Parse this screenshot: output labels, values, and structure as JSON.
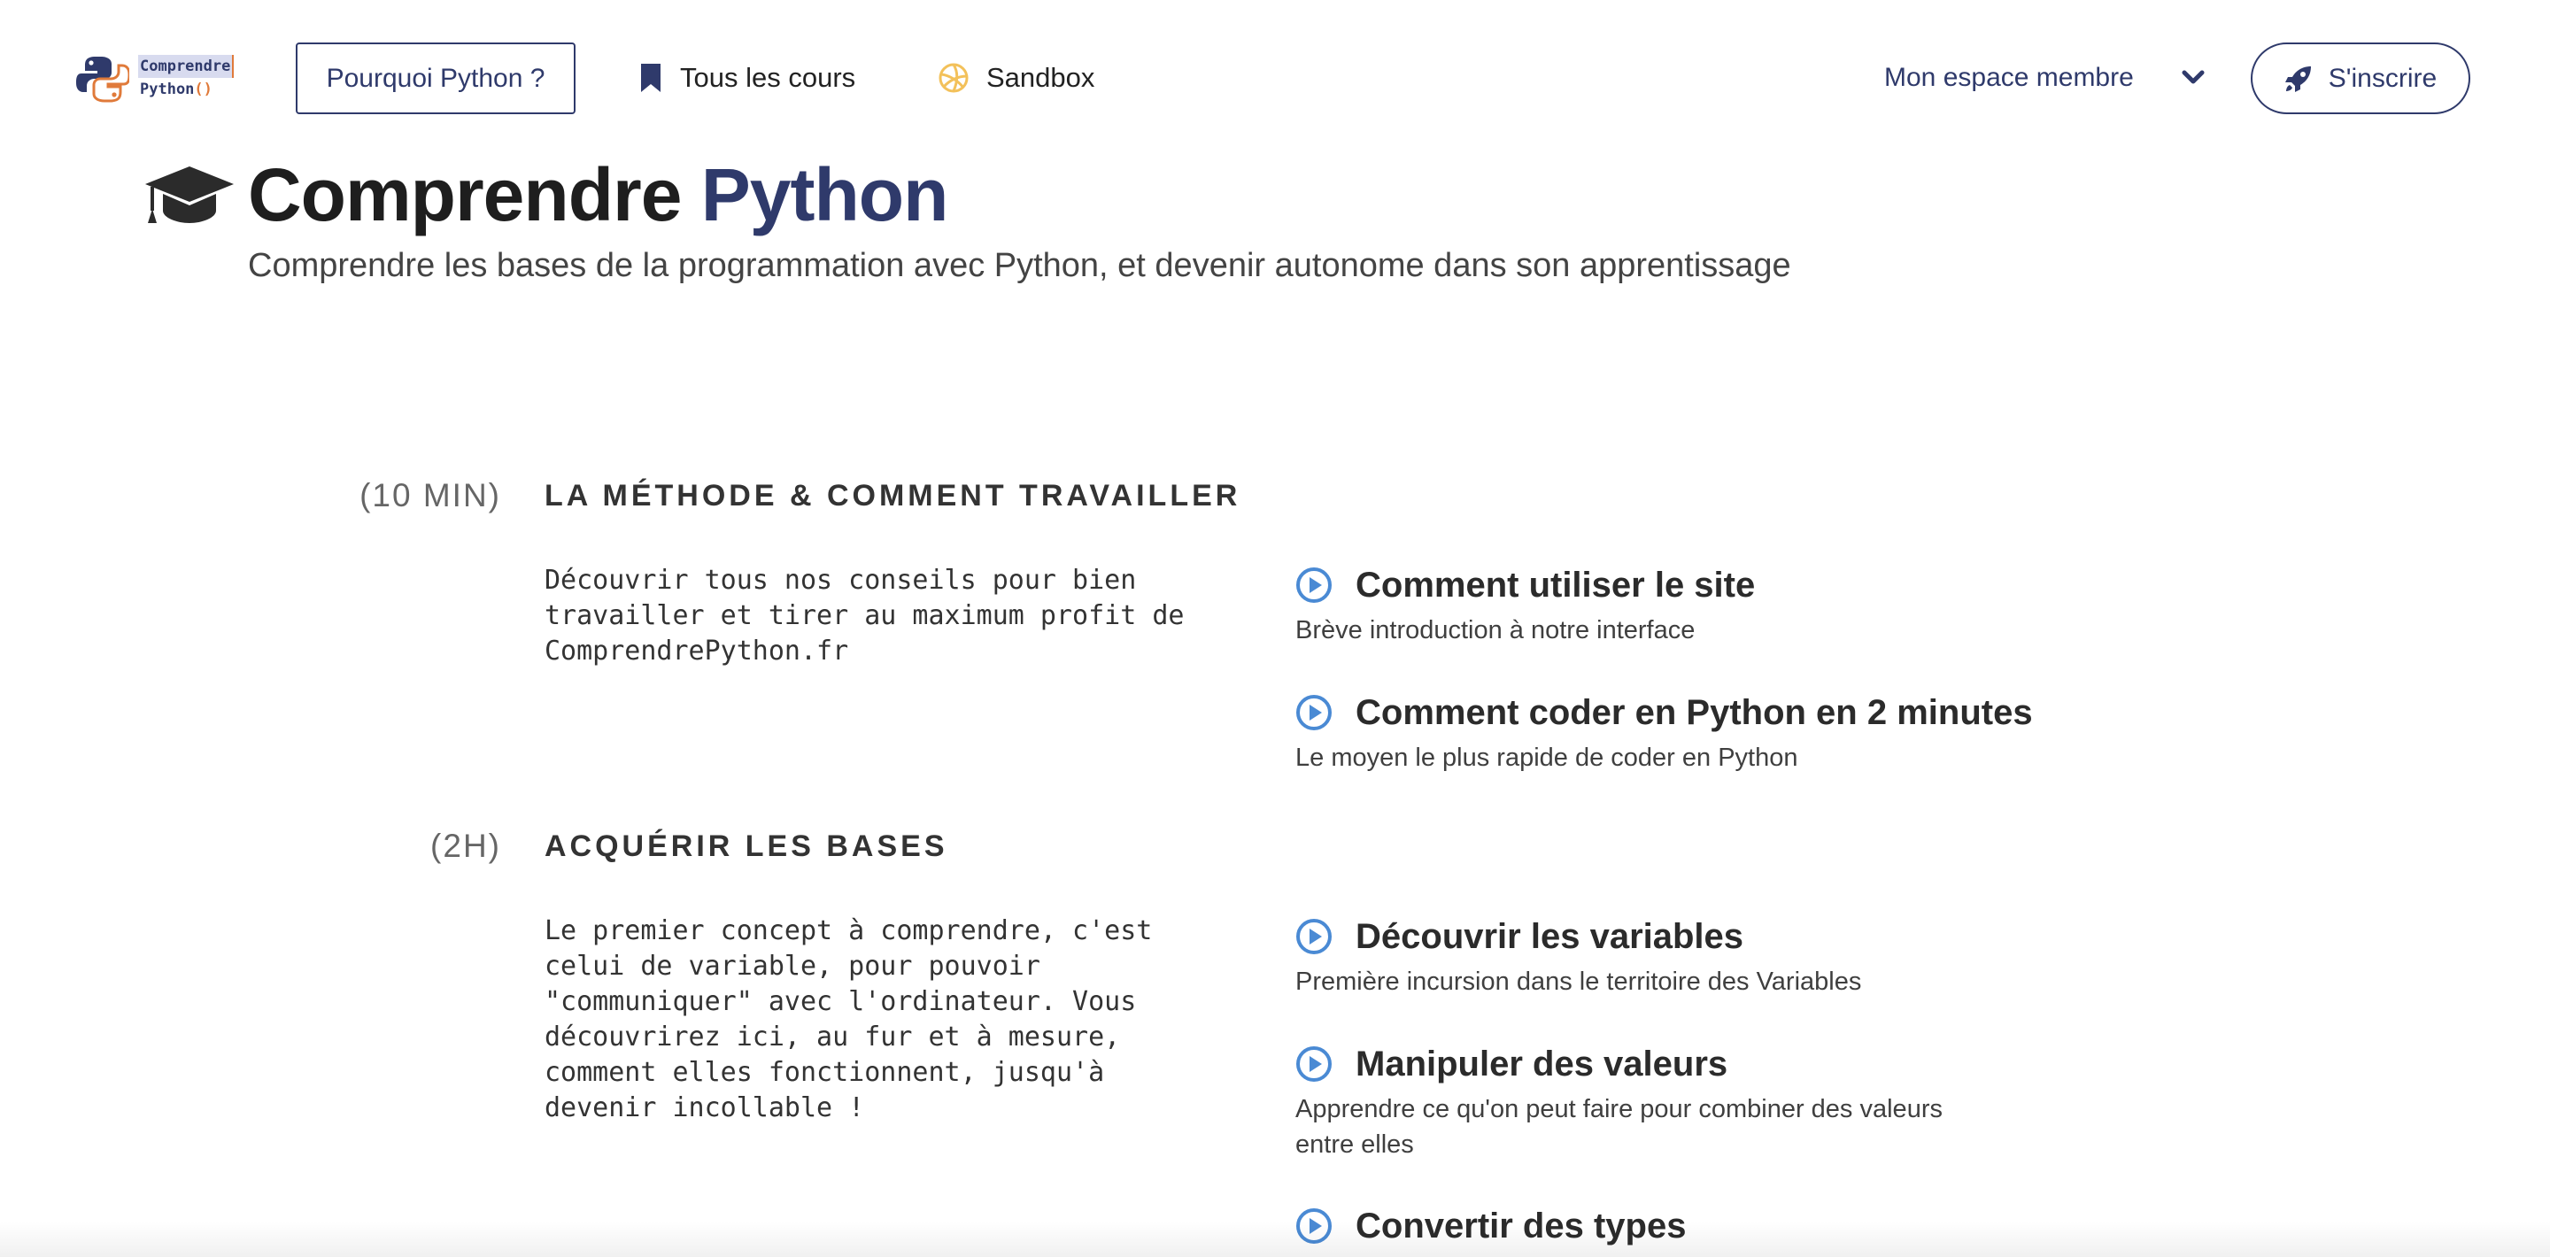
{
  "brand": {
    "logo_line1": "Comprendre",
    "logo_line2": "Python",
    "logo_paren": "()",
    "colors": {
      "primary": "#2f3a6b",
      "accent": "#e07a3a",
      "play": "#4a8ad4",
      "sandbox": "#f3c15a"
    }
  },
  "nav": {
    "why_label": "Pourquoi Python ?",
    "courses_label": "Tous les cours",
    "courses_icon": "bookmark-icon",
    "sandbox_label": "Sandbox",
    "sandbox_icon": "volleyball-icon",
    "member_label": "Mon espace membre",
    "member_icon": "chevron-down-icon",
    "signup_label": "S'inscrire",
    "signup_icon": "rocket-icon"
  },
  "hero": {
    "icon": "graduation-cap-icon",
    "title_part1": "Comprendre",
    "title_part2": "Python",
    "subtitle": "Comprendre les bases de la programmation avec Python, et devenir autonome dans son apprentissage"
  },
  "sections": [
    {
      "duration": "(10 MIN)",
      "title": "LA MÉTHODE & COMMENT TRAVAILLER",
      "description": "Découvrir tous nos conseils pour bien\ntravailler et tirer au maximum profit de\nComprendrePython.fr",
      "lessons": [
        {
          "title": "Comment utiliser le site",
          "subtitle": "Brève introduction à notre interface"
        },
        {
          "title": "Comment coder en Python en 2 minutes",
          "subtitle": "Le moyen le plus rapide de coder en Python"
        }
      ]
    },
    {
      "duration": "(2H)",
      "title": "ACQUÉRIR LES BASES",
      "description": "Le premier concept à comprendre, c'est\ncelui de variable, pour pouvoir\n\"communiquer\" avec l'ordinateur. Vous\ndécouvrirez ici, au fur et à mesure,\ncomment elles fonctionnent, jusqu'à\ndevenir incollable !",
      "lessons": [
        {
          "title": "Découvrir les variables",
          "subtitle": "Première incursion dans le territoire des Variables"
        },
        {
          "title": "Manipuler des valeurs",
          "subtitle": "Apprendre ce qu'on peut faire pour combiner des valeurs\nentre elles"
        },
        {
          "title": "Convertir des types",
          "subtitle": ""
        }
      ]
    }
  ]
}
